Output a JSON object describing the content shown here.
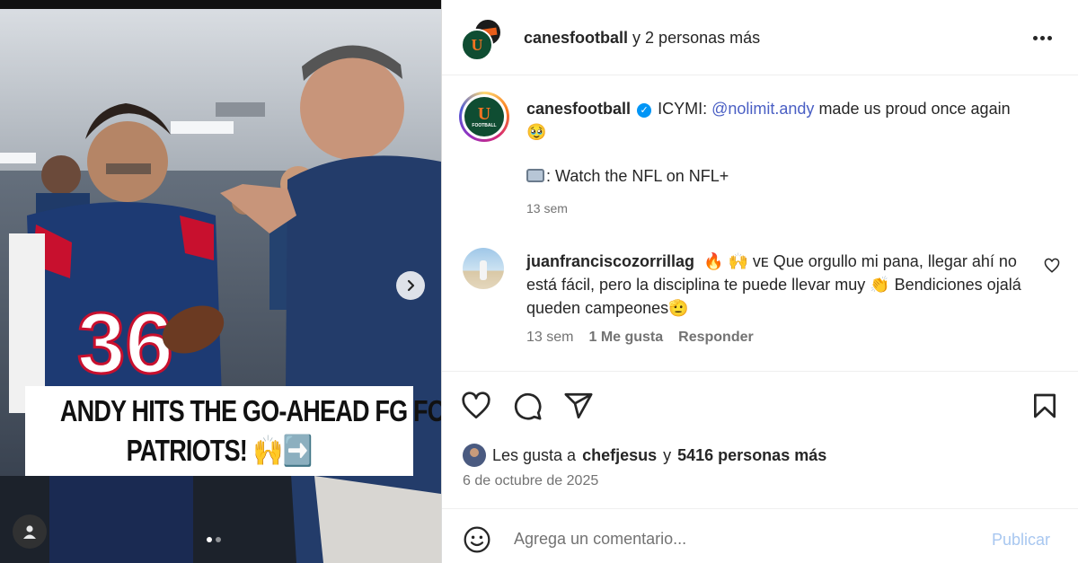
{
  "media": {
    "headline_line1": "ANDY HITS THE GO-AHEAD FG FOR THE",
    "headline_line2": "PATRIOTS! 🙌➡️",
    "slide_count": 2,
    "active_slide": 1
  },
  "header": {
    "account": "canesfootball",
    "collab_text": "y 2 personas más"
  },
  "caption": {
    "username": "canesfootball",
    "text_prefix": "ICYMI:",
    "mention": "@nolimit.andy",
    "text_suffix": "made us proud once again 🥹",
    "line2": ": Watch the NFL on NFL+",
    "time": "13 sem"
  },
  "comment": {
    "username": "juanfranciscozorrillag",
    "text": "🔥 🙌 ᴠᴇ Que orgullo mi pana, llegar ahí no está fácil, pero la disciplina te puede llevar muy 👏 Bendiciones ojalá queden campeones🫡",
    "time": "13 sem",
    "likes": "1 Me gusta",
    "reply": "Responder"
  },
  "likes": {
    "prefix": "Les gusta a",
    "user": "chefjesus",
    "middle": "y",
    "count": "5416 personas más"
  },
  "date": "6 de octubre de 2025",
  "add_comment": {
    "placeholder": "Agrega un comentario...",
    "publish": "Publicar"
  },
  "colors": {
    "link": "#4a5fc4",
    "verified": "#0095f6",
    "publish_disabled": "#a8c7f0",
    "miami_green": "#0f4d32",
    "miami_orange": "#f47321"
  }
}
